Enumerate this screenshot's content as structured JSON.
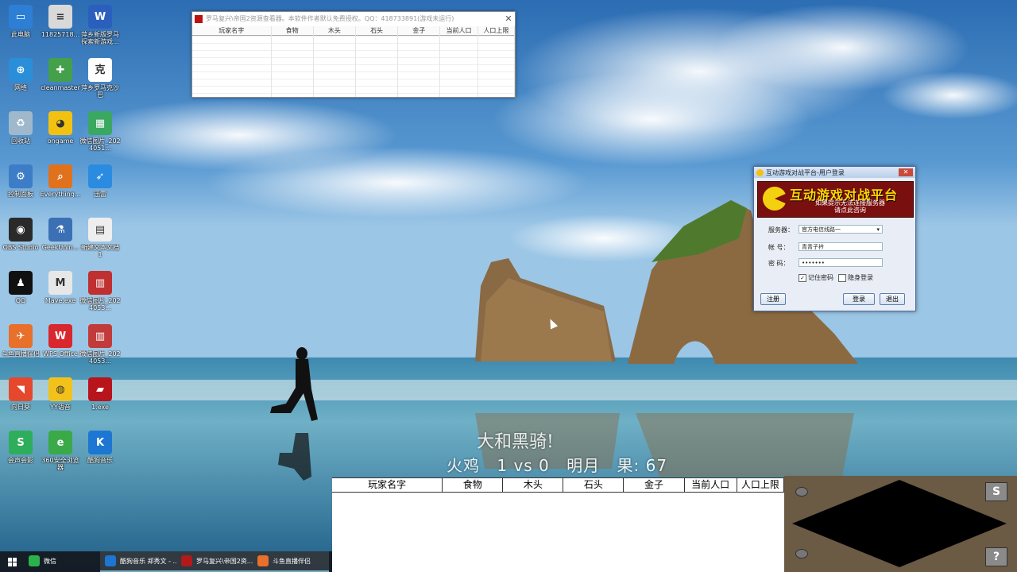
{
  "desktop_icons": [
    {
      "label": "此电脑",
      "color": "#2d7fd6",
      "glyph": "▭",
      "x": 0
    },
    {
      "label": "11825718...",
      "color": "#d9d9d9",
      "glyph": "≡"
    },
    {
      "label": "萍乡新版罗马\n探索新游戏...",
      "color": "#2b5fbd",
      "glyph": "W"
    },
    {
      "label": "网络",
      "color": "#2a8fd8",
      "glyph": "⊕"
    },
    {
      "label": "cleanmaster",
      "color": "#44a04a",
      "glyph": "✚"
    },
    {
      "label": "萍乡罗马克沙巴",
      "color": "#ffffff",
      "glyph": "克"
    },
    {
      "label": "回收站",
      "color": "#9fb8cc",
      "glyph": "♻"
    },
    {
      "label": "ongame",
      "color": "#f3c211",
      "glyph": "◕"
    },
    {
      "label": "微信图片_2024051...",
      "color": "#3aa860",
      "glyph": "▦"
    },
    {
      "label": "控制面板",
      "color": "#3d7dc8",
      "glyph": "⚙"
    },
    {
      "label": "Everything...",
      "color": "#e0711d",
      "glyph": "⌕"
    },
    {
      "label": "迅雷",
      "color": "#2b8be0",
      "glyph": "➶"
    },
    {
      "label": "OBS Studio",
      "color": "#2a2a2a",
      "glyph": "◉"
    },
    {
      "label": "GeekUnin...",
      "color": "#3c70b5",
      "glyph": "⚗"
    },
    {
      "label": "新建文本文档 1",
      "color": "#eeeeee",
      "glyph": "▤"
    },
    {
      "label": "QQ",
      "color": "#111111",
      "glyph": "♟"
    },
    {
      "label": "Maye.exe",
      "color": "#e7e7e7",
      "glyph": "M"
    },
    {
      "label": "微信图片_2024053...",
      "color": "#c03030",
      "glyph": "▥"
    },
    {
      "label": "斗鱼直播伴侣",
      "color": "#e8702a",
      "glyph": "✈"
    },
    {
      "label": "WPS Office",
      "color": "#d9272e",
      "glyph": "W"
    },
    {
      "label": "微信图片_2024053...",
      "color": "#c23b3b",
      "glyph": "▥"
    },
    {
      "label": "向日葵",
      "color": "#e5482c",
      "glyph": "◥"
    },
    {
      "label": "YY语音",
      "color": "#f3c21a",
      "glyph": "◍"
    },
    {
      "label": "1.exe",
      "color": "#b8141b",
      "glyph": "▰"
    },
    {
      "label": "会声会影",
      "color": "#2eae5b",
      "glyph": "S"
    },
    {
      "label": "360安全浏览器",
      "color": "#3aa948",
      "glyph": "e"
    },
    {
      "label": "酷狗音乐",
      "color": "#1c76d2",
      "glyph": "K"
    }
  ],
  "top_window": {
    "title": "罗马复兴\\帝国2资源查看器。本软件作者默认免费授权。QQ：418733891(游戏未运行)",
    "close": "✕",
    "columns": [
      "玩家名字",
      "食物",
      "木头",
      "石头",
      "金子",
      "当前人口",
      "人口上限"
    ]
  },
  "login_window": {
    "title": "互动游戏对战平台-用户登录",
    "close": "✕",
    "banner_title": "互动游戏对战平台",
    "banner_sub": "如果提示无法连接服务器\n请点此咨询",
    "server_label": "服务器：",
    "server_value": "官方电信线路一",
    "account_label": "帐  号：",
    "account_value": "青青子衿",
    "password_label": "密  码：",
    "password_value": "•••••••",
    "remember_label": "记住密码",
    "remember_checked": "✓",
    "stealth_label": "隐身登录",
    "register_button": "注册",
    "login_button": "登录",
    "exit_button": "退出"
  },
  "game_overlay": {
    "banner": "大和黑骑!",
    "score_player": "火鸡",
    "score_value": "1 vs 0",
    "score_opponent": "明月",
    "score_label": "果: 67"
  },
  "bottom_table": {
    "columns": [
      "玩家名字",
      "食物",
      "木头",
      "石头",
      "金子",
      "当前人口",
      "人口上限"
    ]
  },
  "minimap": {
    "top_button": "S",
    "bottom_button": "?"
  },
  "taskbar": {
    "items": [
      {
        "label": "微信",
        "color": "#2ab24b"
      },
      {
        "label": "酷狗音乐 郑秀文 - ...",
        "color": "#1c76d2"
      },
      {
        "label": "罗马复兴\\帝国2资...",
        "color": "#b11a1a"
      },
      {
        "label": "斗鱼直播伴侣",
        "color": "#e8702a"
      }
    ]
  }
}
